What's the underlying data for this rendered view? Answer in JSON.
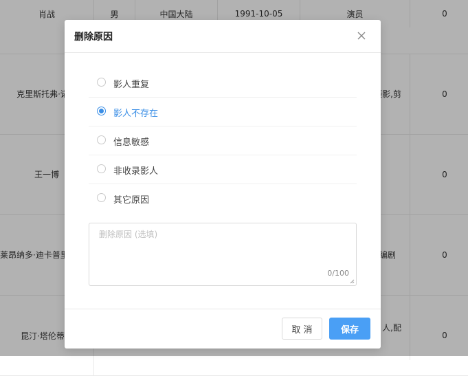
{
  "background_table": {
    "rows": [
      {
        "name": "肖战",
        "gender": "男",
        "region": "中国大陆",
        "birthday": "1991-10-05",
        "role": "演员",
        "count": "0"
      },
      {
        "name": "克里斯托弗·诺兰",
        "gender": "",
        "region": "",
        "birthday": "",
        "role": "摄影,剪",
        "count": "0"
      },
      {
        "name": "王一博",
        "gender": "",
        "region": "",
        "birthday": "",
        "role": "",
        "count": "0"
      },
      {
        "name": "莱昂纳多·迪卡普里奥",
        "gender": "",
        "region": "",
        "birthday": "",
        "role": "编剧",
        "count": "0"
      },
      {
        "name": "昆汀·塔伦蒂诺",
        "gender": "",
        "region": "",
        "birthday": "",
        "role": "人,配",
        "count": "0"
      }
    ]
  },
  "modal": {
    "title": "删除原因",
    "options": [
      {
        "label": "影人重复",
        "checked": false
      },
      {
        "label": "影人不存在",
        "checked": true
      },
      {
        "label": "信息敏感",
        "checked": false
      },
      {
        "label": "非收录影人",
        "checked": false
      },
      {
        "label": "其它原因",
        "checked": false
      }
    ],
    "textarea": {
      "placeholder": "删除原因 (选填)",
      "value": "",
      "counter": "0/100"
    },
    "cancel_label": "取 消",
    "save_label": "保存"
  },
  "colors": {
    "accent": "#3a8ee6",
    "save_button": "#4a9ff5"
  },
  "icons": {
    "close": "close-icon"
  }
}
